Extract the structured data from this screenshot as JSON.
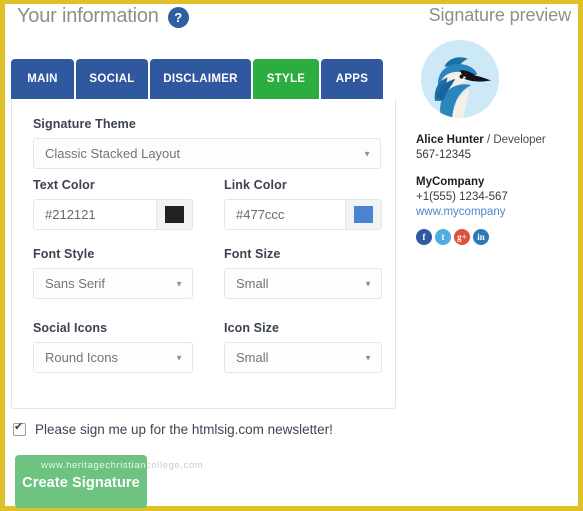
{
  "header": {
    "left_title": "Your information",
    "help_icon": "question-mark-icon",
    "right_title": "Signature preview"
  },
  "tabs": [
    {
      "label": "MAIN",
      "active": false
    },
    {
      "label": "SOCIAL",
      "active": false
    },
    {
      "label": "DISCLAIMER",
      "active": false
    },
    {
      "label": "STYLE",
      "active": true
    },
    {
      "label": "APPS",
      "active": false
    }
  ],
  "colors": {
    "frame_border": "#e0c028",
    "tab_inactive": "#30589f",
    "tab_active": "#2bad40",
    "help_icon_bg": "#2e5fa3",
    "create_button_bg": "#6dc37f",
    "text_color_swatch": "#212121",
    "link_color_swatch": "#4a83d4",
    "link_text": "#4a86c8",
    "avatar_bg": "#cde9f7"
  },
  "form": {
    "signature_theme": {
      "label": "Signature Theme",
      "value": "Classic Stacked Layout"
    },
    "text_color": {
      "label": "Text Color",
      "value": "#212121",
      "swatch": "#212121"
    },
    "link_color": {
      "label": "Link Color",
      "value": "#477ccc",
      "swatch": "#4a83d4"
    },
    "font_style": {
      "label": "Font Style",
      "value": "Sans Serif"
    },
    "font_size": {
      "label": "Font Size",
      "value": "Small"
    },
    "social_icons": {
      "label": "Social Icons",
      "value": "Round Icons"
    },
    "icon_size": {
      "label": "Icon Size",
      "value": "Small"
    }
  },
  "newsletter": {
    "checked": true,
    "label": "Please sign me up for the htmlsig.com newsletter!"
  },
  "create_button": {
    "label": "Create Signature"
  },
  "watermark": {
    "bright": "www.heritagechristian",
    "dim": "college.com"
  },
  "preview": {
    "avatar": "blue-jay-bird-avatar",
    "name": "Alice Hunter",
    "separator": " / ",
    "role": "Developer",
    "phone_ext": "567-12345",
    "company": "MyCompany",
    "phone": "+1(555) 1234-567",
    "website": "www.mycompany",
    "social": [
      {
        "name": "facebook-icon",
        "glyph": "f"
      },
      {
        "name": "twitter-icon",
        "glyph": "t"
      },
      {
        "name": "googleplus-icon",
        "glyph": "g+"
      },
      {
        "name": "linkedin-icon",
        "glyph": "in"
      }
    ]
  }
}
